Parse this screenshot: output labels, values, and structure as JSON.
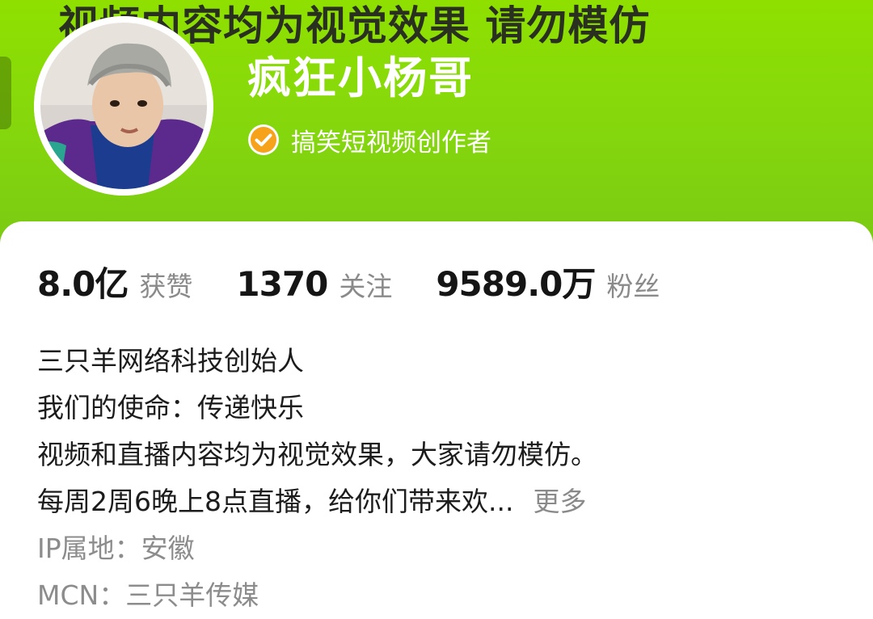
{
  "banner": {
    "text": "视频内容均为视觉效果 请勿模仿"
  },
  "profile": {
    "name": "疯狂小杨哥",
    "verify_icon": "verified-check-icon",
    "badge_label": "搞笑短视频创作者"
  },
  "stats": [
    {
      "value": "8.0亿",
      "label": "获赞"
    },
    {
      "value": "1370",
      "label": "关注"
    },
    {
      "value": "9589.0万",
      "label": "粉丝"
    }
  ],
  "bio": {
    "lines": [
      "三只羊网络科技创始人",
      "我们的使命：传递快乐",
      "视频和直播内容均为视觉效果，大家请勿模仿。",
      "每周2周6晚上8点直播，给你们带来欢..."
    ],
    "more_label": "更多",
    "ip_location": "IP属地：安徽",
    "mcn": "MCN：三只羊传媒"
  },
  "colors": {
    "banner_green": "#8fe000",
    "verify_orange": "#f7a21b",
    "text_primary": "#151515",
    "text_secondary": "#8a8a8a"
  }
}
